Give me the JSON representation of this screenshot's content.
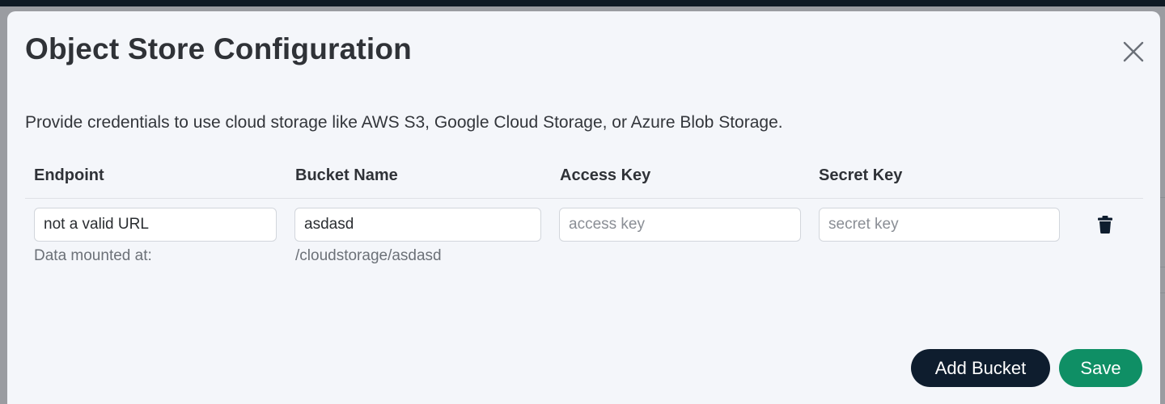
{
  "modal": {
    "title": "Object Store Configuration",
    "description": "Provide credentials to use cloud storage like AWS S3, Google Cloud Storage, or Azure Blob Storage."
  },
  "table": {
    "headers": [
      "Endpoint",
      "Bucket Name",
      "Access Key",
      "Secret Key"
    ],
    "rows": [
      {
        "endpoint": "not a valid URL",
        "endpoint_help": "Data mounted at:",
        "bucket_name": "asdasd",
        "bucket_help": "/cloudstorage/asdasd",
        "access_key": "",
        "access_key_placeholder": "access key",
        "secret_key": "",
        "secret_key_placeholder": "secret key"
      }
    ]
  },
  "actions": {
    "add_bucket_label": "Add Bucket",
    "save_label": "Save"
  },
  "colors": {
    "add_bucket_bg": "#0e1d2e",
    "save_bg": "#0f8f65",
    "modal_bg": "#f4f6fa"
  },
  "icons": {
    "close": "close-icon",
    "delete": "trash-icon"
  }
}
